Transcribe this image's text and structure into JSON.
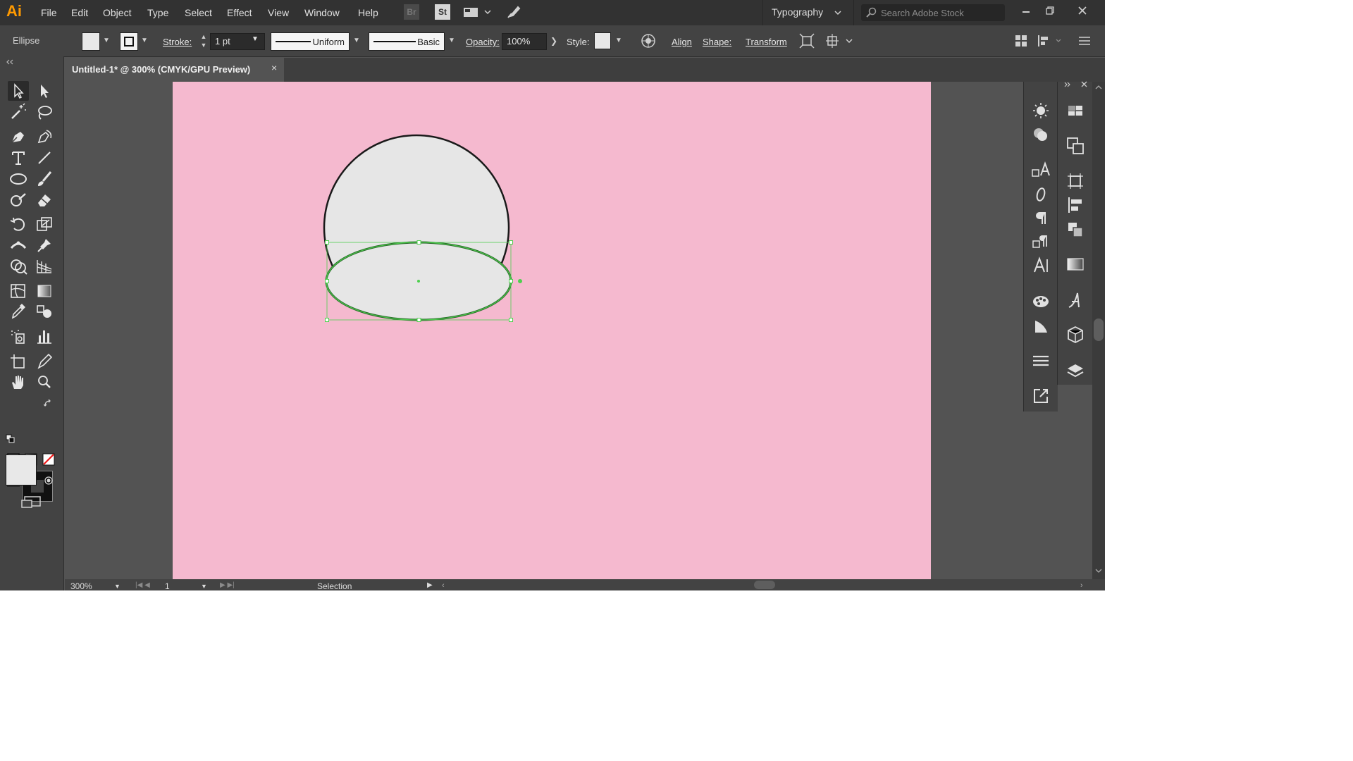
{
  "app": {
    "logo": "Ai",
    "menus": [
      "File",
      "Edit",
      "Object",
      "Type",
      "Select",
      "Effect",
      "View",
      "Window",
      "Help"
    ],
    "bridge_label": "Br",
    "stock_label": "St",
    "workspace": "Typography",
    "search_placeholder": "Search Adobe Stock"
  },
  "control_bar": {
    "selection_type": "Ellipse",
    "stroke_label": "Stroke:",
    "stroke_weight": "1 pt",
    "variable_width": "Uniform",
    "brush": "Basic",
    "opacity_label": "Opacity:",
    "opacity_value": "100%",
    "style_label": "Style:",
    "align_label": "Align",
    "shape_label": "Shape:",
    "transform_label": "Transform"
  },
  "document": {
    "tab_title": "Untitled-1* @ 300% (CMYK/GPU Preview)",
    "close_glyph": "×"
  },
  "status_bar": {
    "zoom": "300%",
    "artboard_number": "1",
    "tool": "Selection"
  },
  "colors": {
    "artboard": "#f5b9cf",
    "shape_fill": "#e6e6e6",
    "selection": "#4ecf4e",
    "accent": "#ff9a00"
  }
}
